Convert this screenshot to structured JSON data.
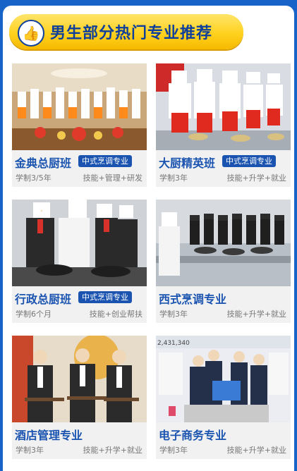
{
  "header": {
    "title": "男生部分热门专业推荐",
    "icon": "thumbs-up-icon"
  },
  "colors": {
    "background": "#1763c8",
    "banner": "#ffd21f",
    "accent": "#1a54b0"
  },
  "courses": [
    {
      "name": "金典总厨班",
      "tag": "中式烹调专业",
      "duration": "学制3/5年",
      "features": "技能+管理+研发"
    },
    {
      "name": "大厨精英班",
      "tag": "中式烹调专业",
      "duration": "学制3年",
      "features": "技能+升学+就业"
    },
    {
      "name": "行政总厨班",
      "tag": "中式烹调专业",
      "duration": "学制6个月",
      "features": "技能+创业帮扶"
    },
    {
      "name": "西式烹调专业",
      "tag": "",
      "duration": "学制3年",
      "features": "技能+升学+就业"
    },
    {
      "name": "酒店管理专业",
      "tag": "",
      "duration": "学制3年",
      "features": "技能+升学+就业"
    },
    {
      "name": "电子商务专业",
      "tag": "",
      "duration": "学制3年",
      "features": "技能+升学+就业"
    }
  ],
  "photo_texts": {
    "ecommerce_screen": "2,431,340"
  }
}
